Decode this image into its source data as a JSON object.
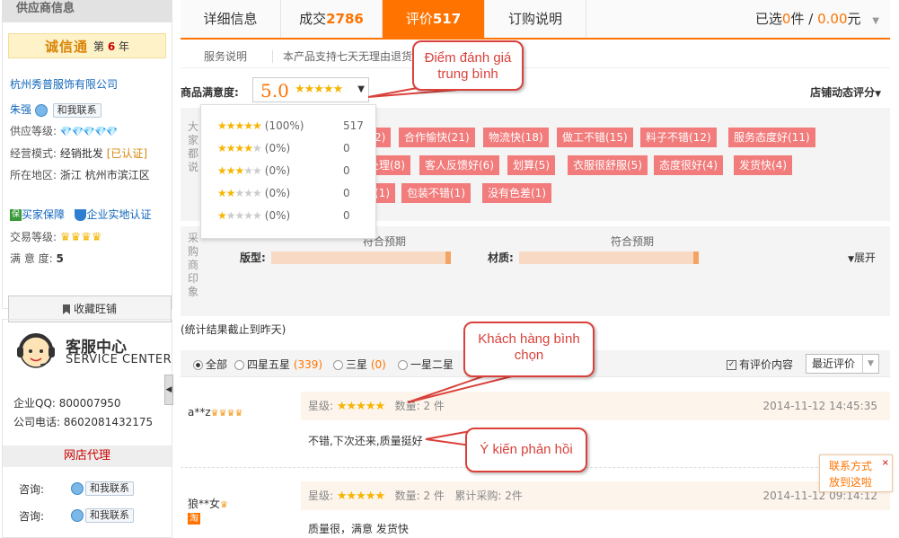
{
  "sidebar": {
    "header": "供应商信息",
    "chengxin_logo": "诚信通",
    "chengxin_year_prefix": "第",
    "chengxin_year": "6",
    "chengxin_year_suffix": "年",
    "company": "杭州秀普服饰有限公司",
    "contact_name": "朱强",
    "contact_button": "和我联系",
    "supply_level_label": "供应等级:",
    "supply_level_icons": "💎💎💎💎💎",
    "business_mode_label": "经营模式:",
    "business_mode_value": "经销批发",
    "business_mode_badge": "[已认证]",
    "region_label": "所在地区:",
    "region_value": "浙江 杭州市滨江区",
    "buyer_protect": "买家保障",
    "enterprise_cert": "企业实地认证",
    "trade_level_label": "交易等级:",
    "satisfaction_label": "满 意 度:",
    "satisfaction_value": "5",
    "fav_button": "收藏旺铺",
    "service_title": "客服中心",
    "service_subtitle": "SERVICE CENTER",
    "qq_label": "企业QQ:",
    "qq_value": "800007950",
    "phone_label": "公司电话:",
    "phone_value": "8602081432175",
    "agent_title": "网店代理",
    "consult_label": "咨询:",
    "consult_button": "和我联系"
  },
  "tabs": [
    {
      "label": "详细信息",
      "count": ""
    },
    {
      "label": "成交",
      "count": "2786"
    },
    {
      "label": "评价",
      "count": "517"
    },
    {
      "label": "订购说明",
      "count": ""
    }
  ],
  "selected": {
    "prefix": "已选",
    "count": "0",
    "unit": "件",
    "sep": "/",
    "amount": "0.00",
    "currency": "元"
  },
  "service_bar": {
    "label": "服务说明",
    "text": "本产品支持七天无理由退货"
  },
  "satisfaction": {
    "label": "商品满意度:",
    "score": "5.0",
    "stars": 5,
    "dynamic_label": "店铺动态评分",
    "distribution": [
      {
        "stars": 5,
        "pct": "(100%)",
        "count": "517"
      },
      {
        "stars": 4,
        "pct": "(0%)",
        "count": "0"
      },
      {
        "stars": 3,
        "pct": "(0%)",
        "count": "0"
      },
      {
        "stars": 2,
        "pct": "(0%)",
        "count": "0"
      },
      {
        "stars": 1,
        "pct": "(0%)",
        "count": "0"
      }
    ]
  },
  "tags_side_label": "大家都说",
  "tags": [
    "2)",
    "合作愉快(21)",
    "物流快(18)",
    "做工不错(15)",
    "料子不错(12)",
    "服务态度好(11)",
    "处理(8)",
    "客人反馈好(6)",
    "划算(5)",
    "衣服很舒服(5)",
    "态度很好(4)",
    "发货快(4)",
    "(1)",
    "包装不错(1)",
    "没有色差(1)"
  ],
  "impression": {
    "side_label": "采购商印象",
    "items": [
      {
        "label": "版型:",
        "mid": "符合预期"
      },
      {
        "label": "材质:",
        "mid": "符合预期"
      }
    ],
    "expand": "展开"
  },
  "stats_note": "(统计结果截止到昨天)",
  "filter": {
    "options": [
      {
        "label": "全部",
        "count": ""
      },
      {
        "label": "四星五星",
        "count": "(339)"
      },
      {
        "label": "三星",
        "count": "(0)"
      },
      {
        "label": "一星二星",
        "count": ""
      }
    ],
    "has_content_label": "有评价内容",
    "sort_label": "最近评价"
  },
  "reviews": [
    {
      "user": "a**z",
      "crowns": "♛♛♛♛",
      "badge": "",
      "star_label": "星级:",
      "qty": "数量: 2 件",
      "cumulative": "",
      "date": "2014-11-12 14:45:35",
      "text": "不错,下次还来,质量挺好"
    },
    {
      "user": "狼**女",
      "crowns": "♛",
      "badge": "淘",
      "star_label": "星级:",
      "qty": "数量: 2 件",
      "cumulative": "累计采购: 2件",
      "date": "2014-11-12 09:14:12",
      "text": "质量很，满意 发货快"
    }
  ],
  "callouts": {
    "avg_rating": "Điểm đánh giá trung bình",
    "customer_vote": "Khách hàng bình chọn",
    "feedback": "Ý kiến phản hồi"
  },
  "float_contact": {
    "line1": "联系方式",
    "line2": "放到这啦",
    "close": "×"
  },
  "colors": {
    "accent": "#ff7300",
    "tag": "#f27b7b",
    "callout": "#d9413a",
    "star": "#f7b500"
  }
}
